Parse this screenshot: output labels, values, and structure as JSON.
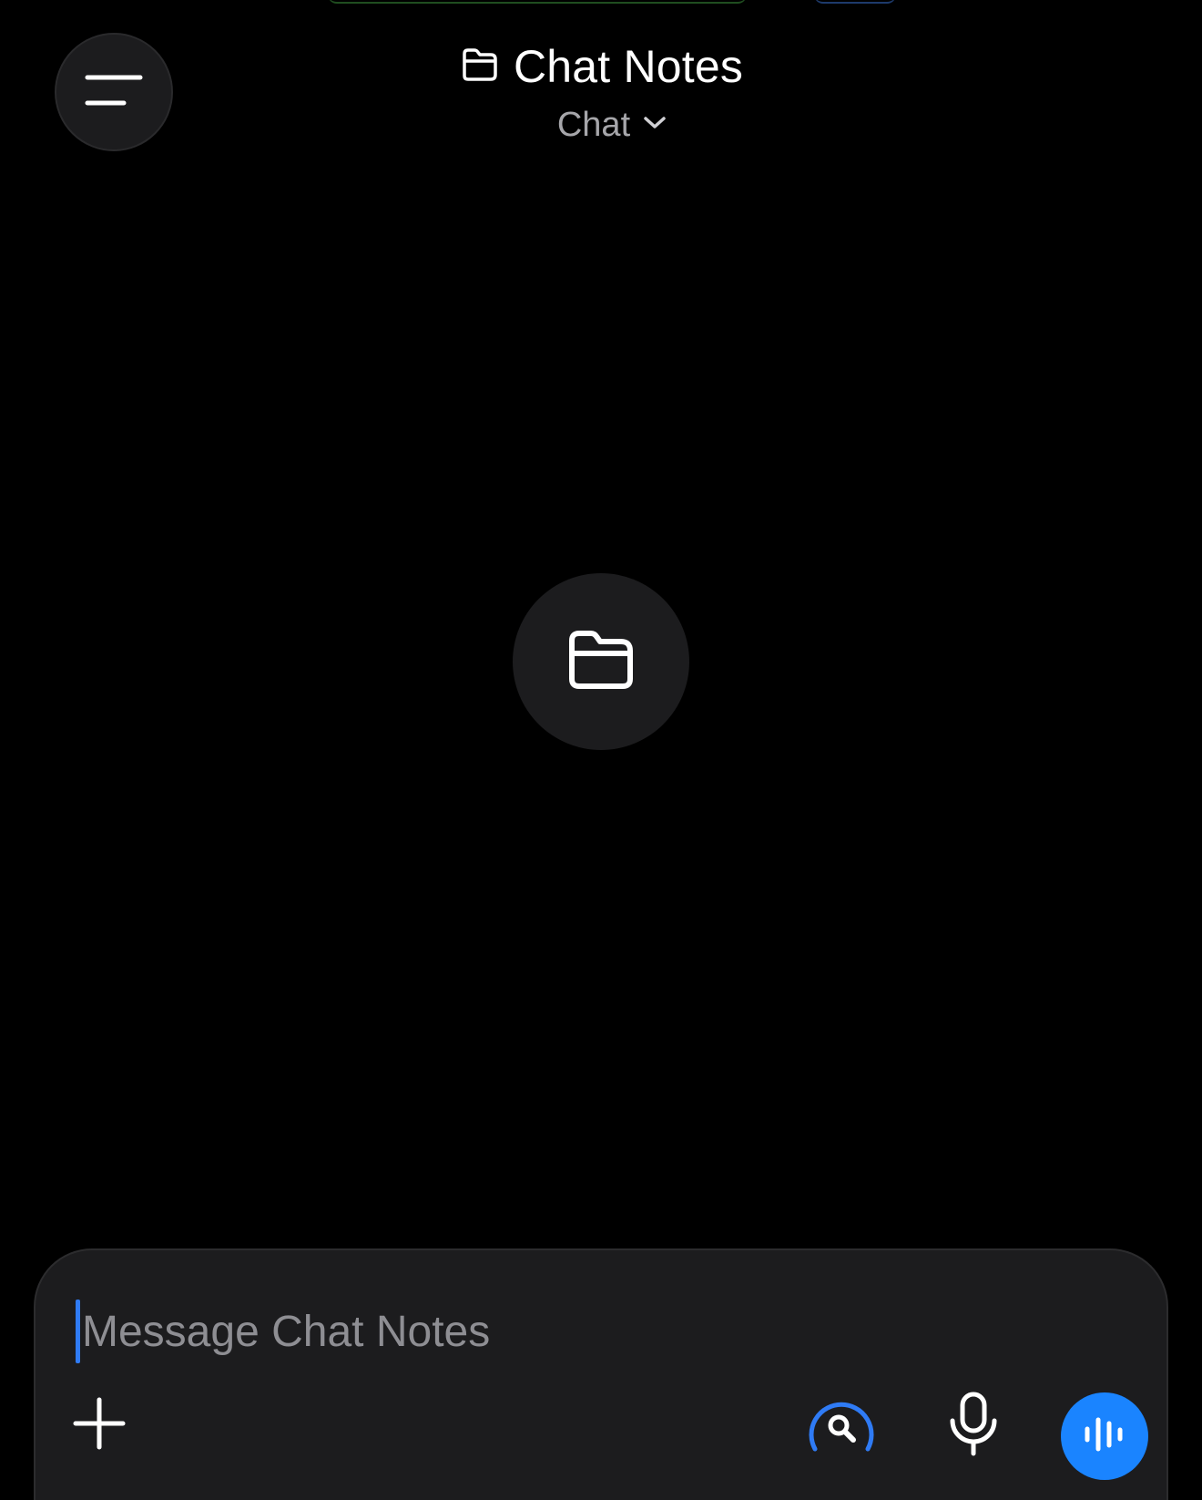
{
  "header": {
    "title": "Chat Notes",
    "mode": "Chat",
    "icons": {
      "menu": "menu-icon",
      "title": "folder-icon",
      "mode": "chevron-down-icon"
    }
  },
  "center": {
    "icon": "folder-icon"
  },
  "composer": {
    "placeholder": "Message Chat Notes",
    "icons": {
      "add": "plus-icon",
      "search": "search-icon",
      "mic": "microphone-icon",
      "voice": "voice-waveform-icon"
    }
  },
  "colors": {
    "background": "#000000",
    "surface": "#1c1c1e",
    "accent": "#1a84ff",
    "muted_text": "#8e8e93"
  }
}
